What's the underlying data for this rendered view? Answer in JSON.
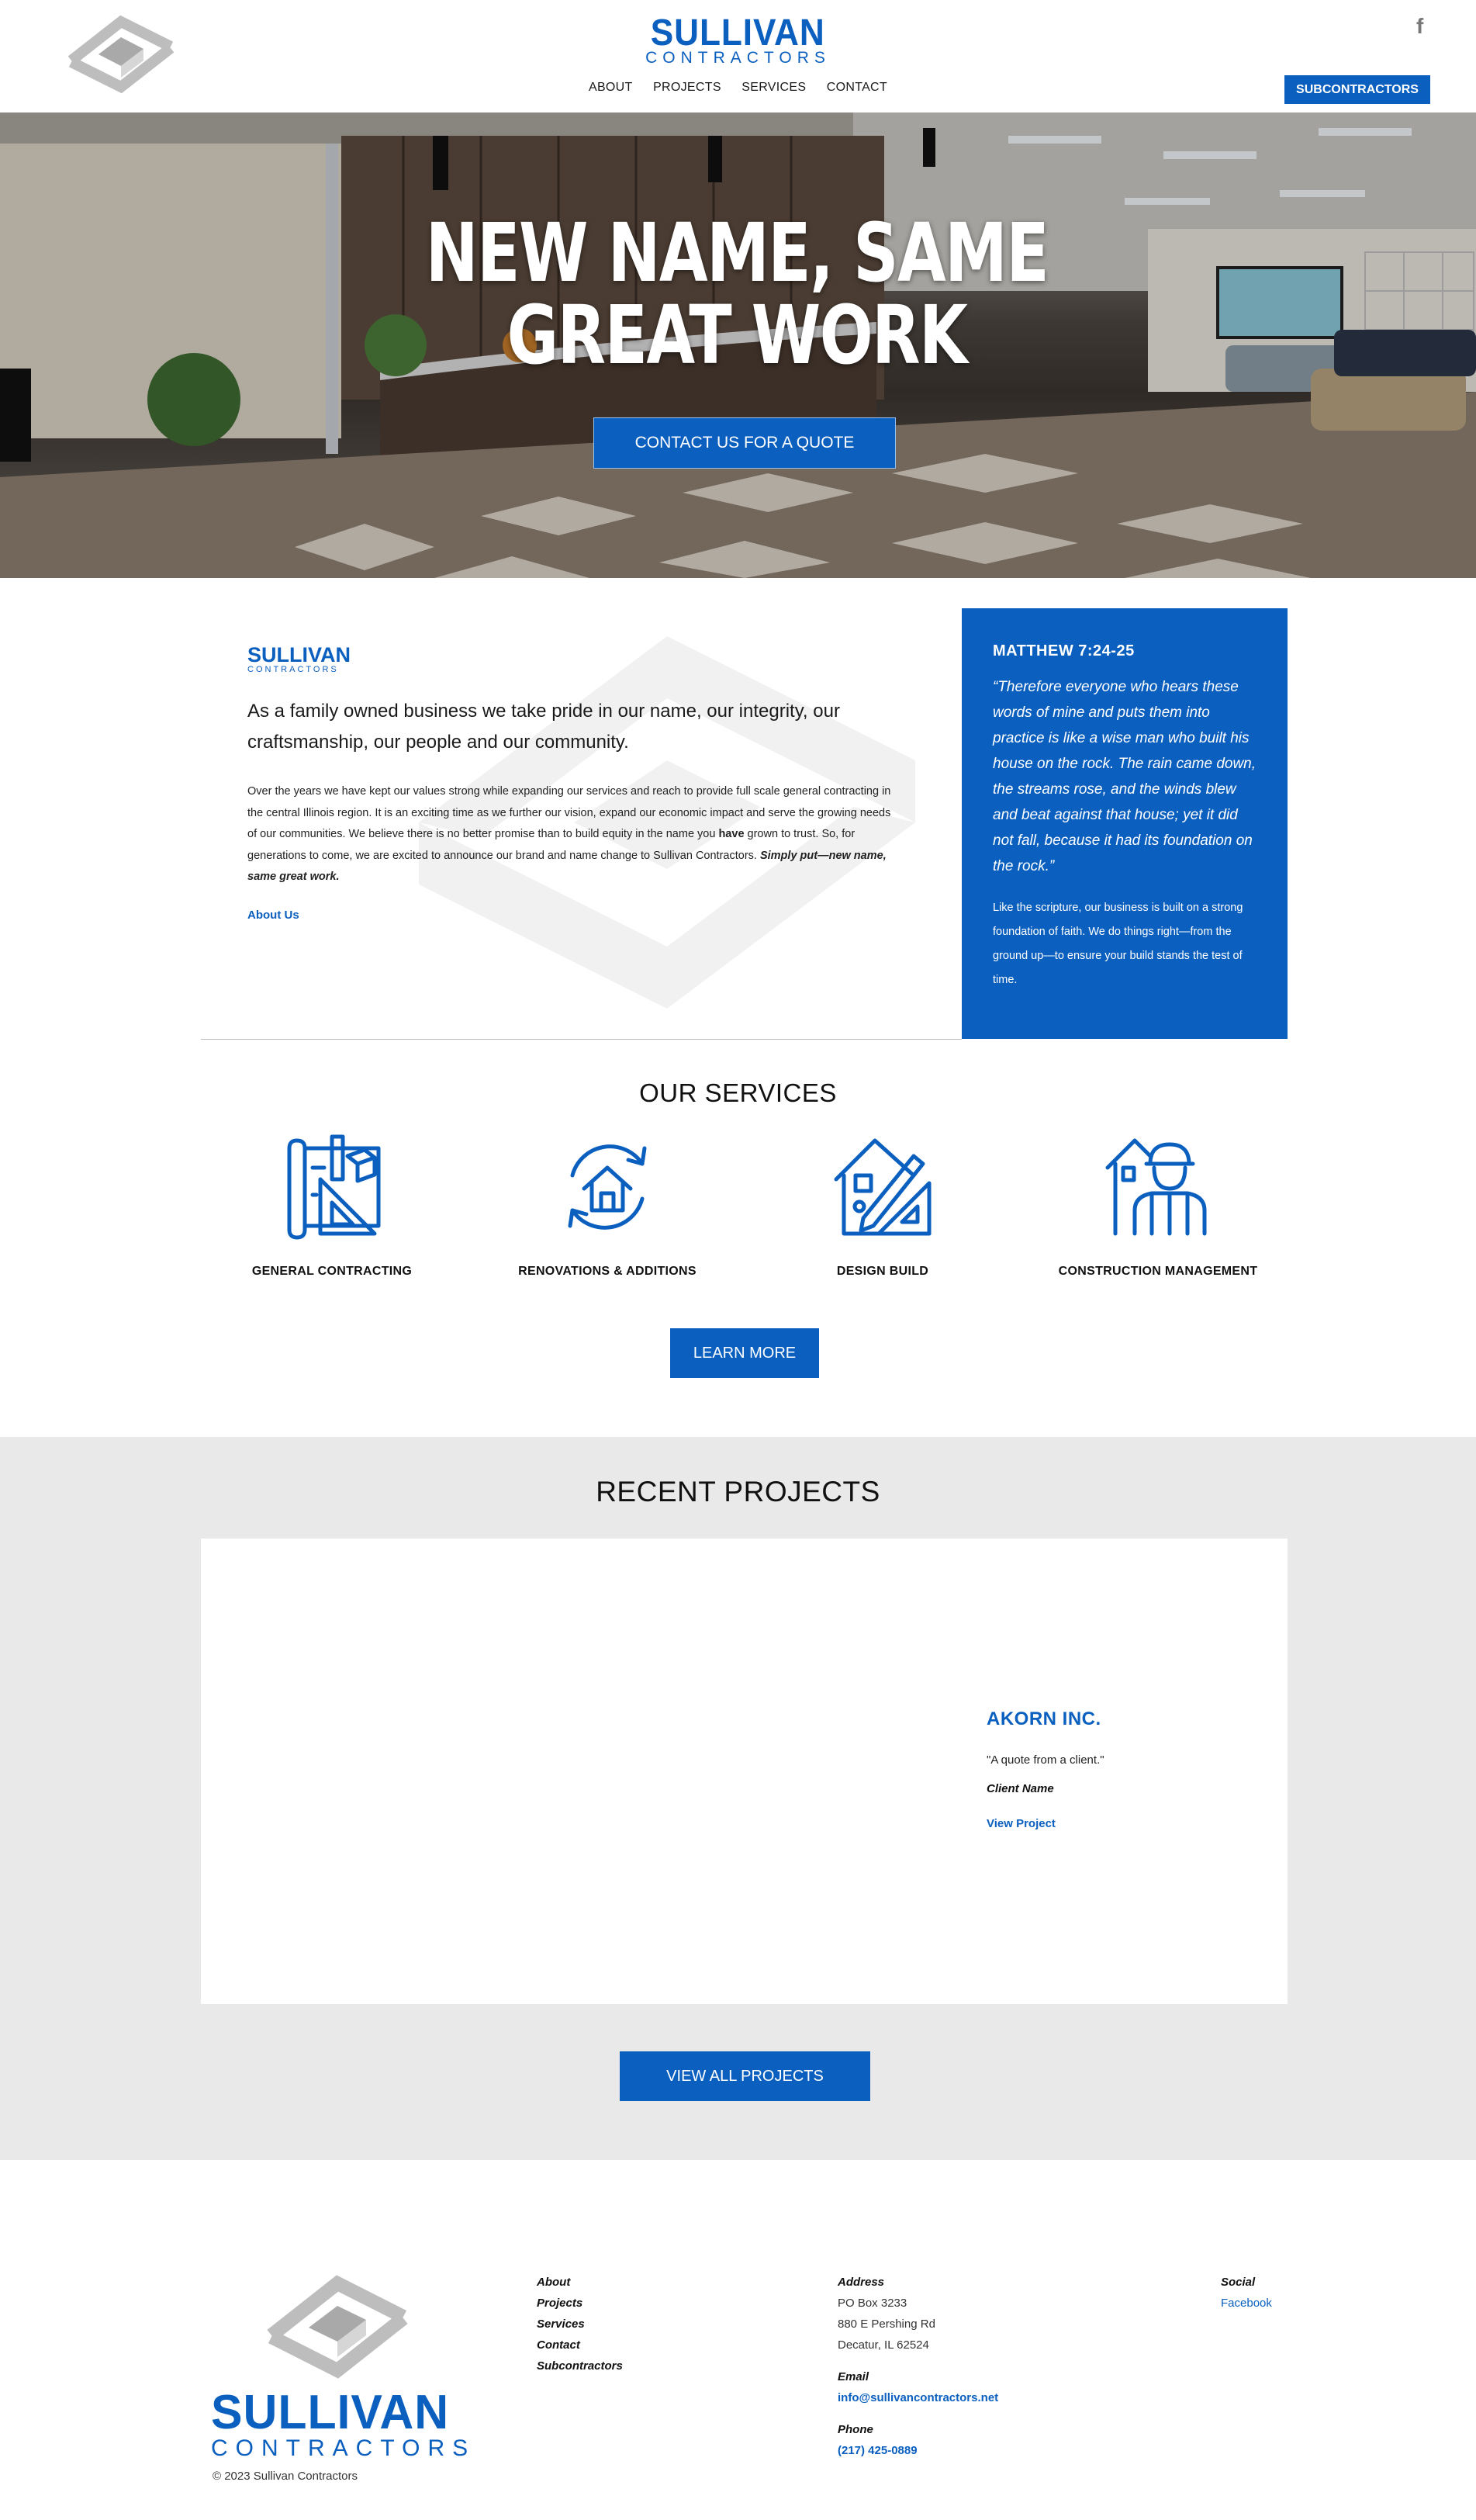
{
  "header": {
    "brand_name": "SULLIVAN",
    "brand_sub": "CONTRACTORS",
    "nav": [
      "ABOUT",
      "PROJECTS",
      "SERVICES",
      "CONTACT"
    ],
    "subcontractors_btn": "SUBCONTRACTORS",
    "social_icon": "facebook-icon"
  },
  "hero": {
    "title": "NEW NAME, SAME GREAT WORK",
    "cta": "CONTACT US FOR A QUOTE"
  },
  "about": {
    "logo_name": "SULLIVAN",
    "logo_sub": "CONTRACTORS",
    "lead": "As a family owned business we take pride in our name, our integrity, our craftsmanship, our people and our community.",
    "body_1": "Over the years we have kept our values strong while expanding our services and reach to provide full scale general contracting in the central Illinois region. It is an exciting time as we further our vision, expand our economic impact and serve the growing needs of our communities. We believe there is no better promise than to build equity in the name you ",
    "body_bold": "have",
    "body_2": " grown to trust. So, for generations to come, we are excited to announce our brand and name change to Sullivan Contractors. ",
    "body_emph": "Simply put—new name, same great work.",
    "link": "About Us"
  },
  "verse": {
    "reference": "MATTHEW 7:24-25",
    "quote": "“Therefore everyone who hears these words of mine and puts them into practice is like a wise man who built his house on the rock. The rain came down, the streams rose, and the winds blew and beat against that house; yet it did not fall, because it had its foundation on the rock.”",
    "note": "Like the scripture, our business is built on a strong foundation of faith. We do things right—from the ground up—to ensure your build stands the test of time."
  },
  "services": {
    "title": "OUR SERVICES",
    "items": [
      {
        "label": "GENERAL CONTRACTING",
        "icon": "blueprint-icon"
      },
      {
        "label": "RENOVATIONS & ADDITIONS",
        "icon": "house-refresh-icon"
      },
      {
        "label": "DESIGN BUILD",
        "icon": "house-design-icon"
      },
      {
        "label": "CONSTRUCTION MANAGEMENT",
        "icon": "worker-icon"
      }
    ],
    "cta": "LEARN MORE"
  },
  "projects": {
    "title": "RECENT PROJECTS",
    "featured": {
      "name": "AKORN INC.",
      "quote": "\"A quote from a client.\"",
      "client": "Client Name",
      "link": "View Project"
    },
    "cta": "VIEW ALL PROJECTS"
  },
  "footer": {
    "brand_name": "SULLIVAN",
    "brand_sub": "CONTRACTORS",
    "copyright": "© 2023 Sullivan Contractors",
    "links": [
      "About",
      "Projects",
      "Services",
      "Contact",
      "Subcontractors"
    ],
    "address_heading": "Address",
    "address_lines": [
      "PO Box 3233",
      "880 E Pershing Rd",
      "Decatur, IL 62524"
    ],
    "email_heading": "Email",
    "email": "info@sullivancontractors.net",
    "phone_heading": "Phone",
    "phone": "(217) 425-0889",
    "social_heading": "Social",
    "social_link": "Facebook"
  },
  "colors": {
    "brand_blue": "#0a5fbf",
    "projects_bg": "#e9e9e9"
  }
}
